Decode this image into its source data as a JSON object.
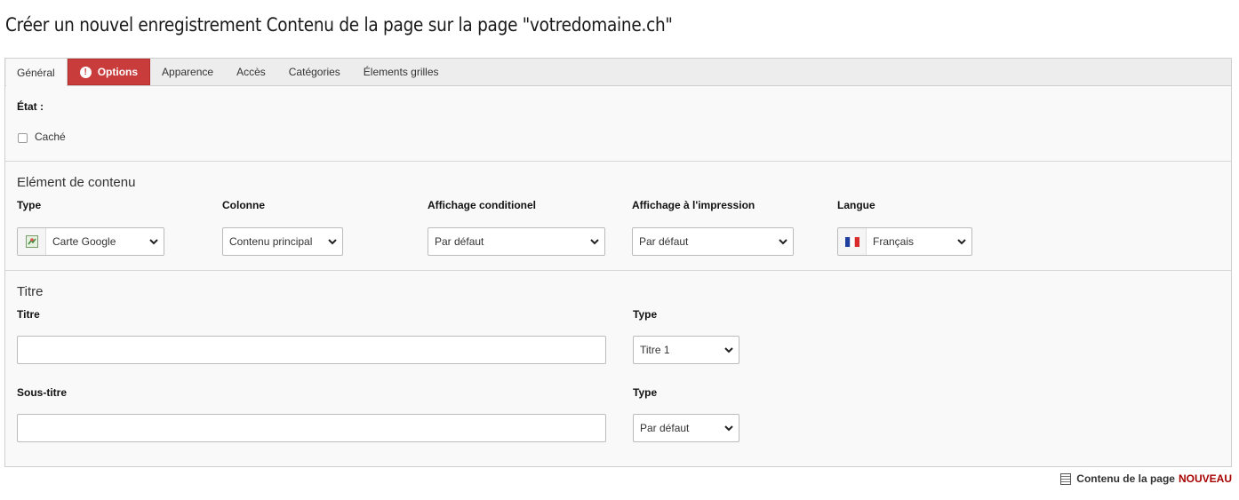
{
  "page_title": "Créer un nouvel enregistrement Contenu de la page sur la page \"votredomaine.ch\"",
  "tabs": [
    {
      "label": "Général",
      "active": true
    },
    {
      "label": "Options",
      "error": true
    },
    {
      "label": "Apparence"
    },
    {
      "label": "Accès"
    },
    {
      "label": "Catégories"
    },
    {
      "label": "Élements grilles"
    }
  ],
  "state": {
    "label": "État :",
    "hidden_label": "Caché",
    "hidden_checked": false
  },
  "content_element": {
    "section_title": "Elément de contenu",
    "fields": [
      {
        "label": "Type",
        "value": "Carte Google",
        "icon": "google-map-icon"
      },
      {
        "label": "Colonne",
        "value": "Contenu principal"
      },
      {
        "label": "Affichage conditionel",
        "value": "Par défaut"
      },
      {
        "label": "Affichage à l'impression",
        "value": "Par défaut"
      },
      {
        "label": "Langue",
        "value": "Français",
        "icon": "french-flag-icon"
      }
    ]
  },
  "title_section": {
    "section_title": "Titre",
    "title_label": "Titre",
    "title_value": "",
    "title_type_label": "Type",
    "title_type_value": "Titre 1",
    "subtitle_label": "Sous-titre",
    "subtitle_value": "",
    "subtitle_type_label": "Type",
    "subtitle_type_value": "Par défaut"
  },
  "footer": {
    "label": "Contenu de la page",
    "status": "NOUVEAU",
    "icon": "document-icon"
  },
  "colors": {
    "error_tab": "#c83c3c",
    "new_status": "#a80000"
  }
}
